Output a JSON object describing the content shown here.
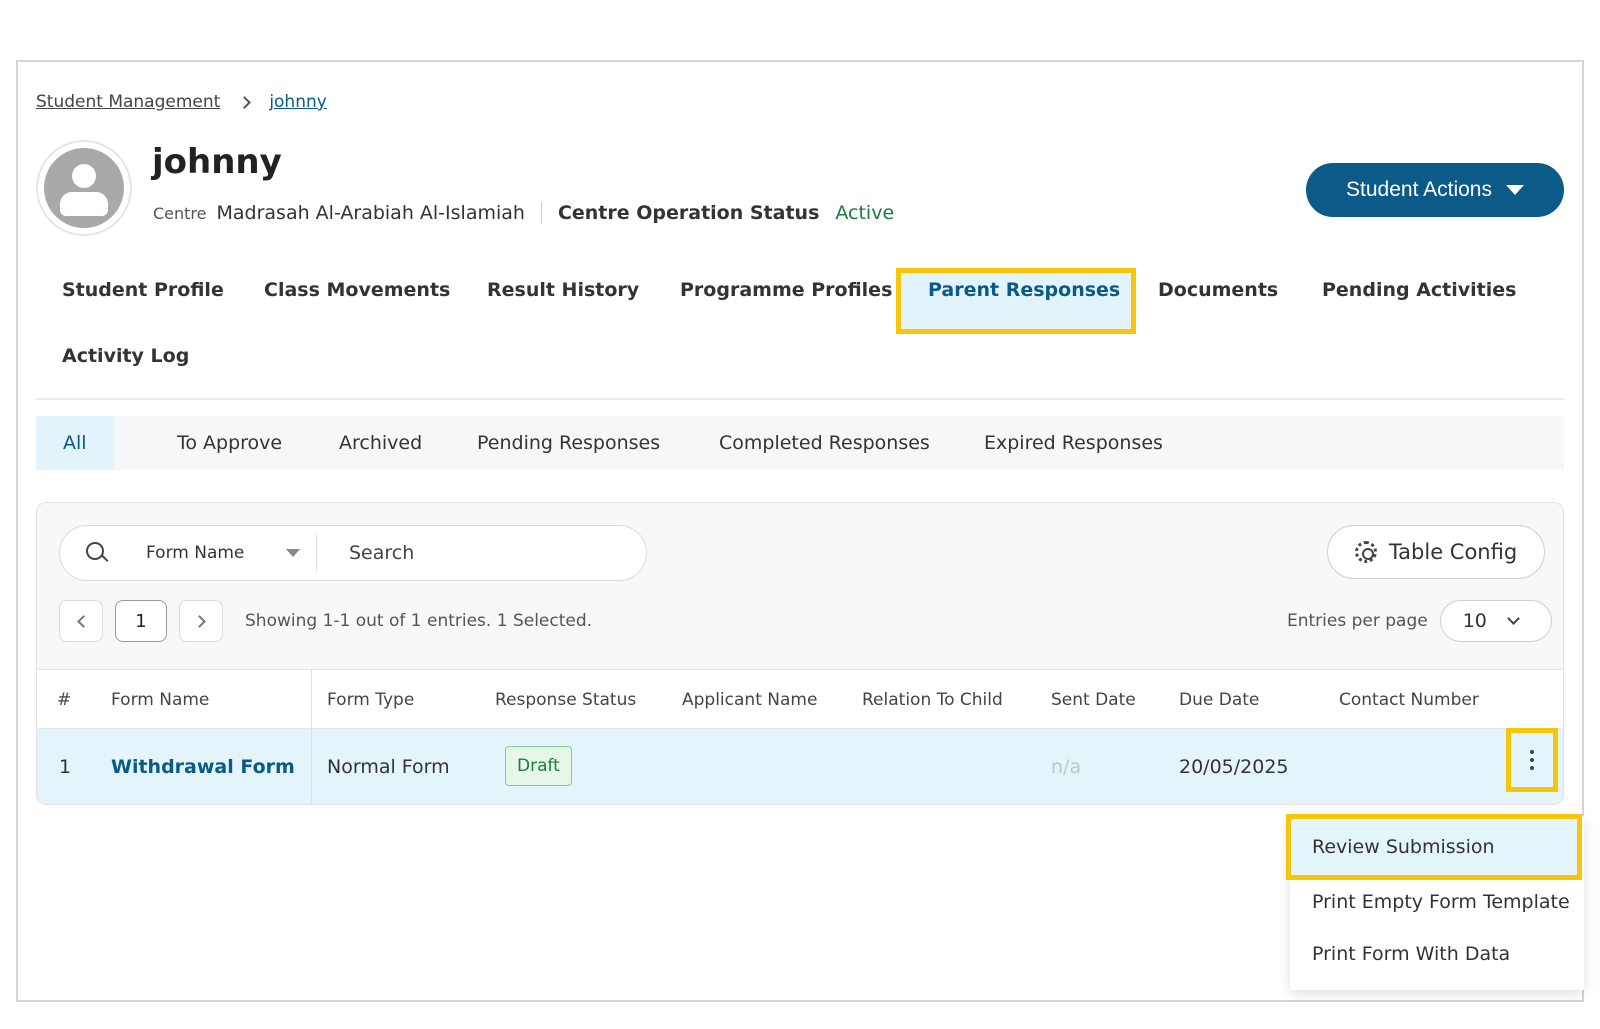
{
  "breadcrumb": {
    "root": "Student Management",
    "current": "johnny"
  },
  "student": {
    "name": "johnny",
    "centre_label": "Centre",
    "centre": "Madrasah Al-Arabiah Al-Islamiah",
    "status_label": "Centre Operation Status",
    "status": "Active"
  },
  "actions": {
    "label": "Student Actions"
  },
  "tabs": [
    {
      "label": "Student Profile"
    },
    {
      "label": "Class Movements"
    },
    {
      "label": "Result History"
    },
    {
      "label": "Programme Profiles"
    },
    {
      "label": "Parent Responses"
    },
    {
      "label": "Documents"
    },
    {
      "label": "Pending Activities"
    },
    {
      "label": "Activity Log"
    }
  ],
  "subtabs": [
    {
      "label": "All"
    },
    {
      "label": "To Approve"
    },
    {
      "label": "Archived"
    },
    {
      "label": "Pending Responses"
    },
    {
      "label": "Completed Responses"
    },
    {
      "label": "Expired Responses"
    }
  ],
  "search": {
    "field": "Form Name",
    "placeholder": "Search"
  },
  "table_config": {
    "label": "Table Config"
  },
  "pagination": {
    "page": "1",
    "showing": "Showing 1-1 out of 1 entries. 1 Selected.",
    "entries_label": "Entries per page",
    "entries_value": "10"
  },
  "table": {
    "headers": [
      "#",
      "Form Name",
      "Form Type",
      "Response Status",
      "Applicant Name",
      "Relation To Child",
      "Sent Date",
      "Due Date",
      "Contact Number"
    ],
    "rows": [
      {
        "index": "1",
        "form_name": "Withdrawal Form",
        "form_type": "Normal Form",
        "response_status": "Draft",
        "applicant_name": "",
        "relation": "",
        "sent_date": "n/a",
        "due_date": "20/05/2025",
        "contact": ""
      }
    ]
  },
  "menu": {
    "items": [
      {
        "label": "Review Submission"
      },
      {
        "label": "Print Empty Form Template"
      },
      {
        "label": "Print Form With Data"
      }
    ]
  },
  "colors": {
    "primary": "#0b5a87",
    "highlight": "#f5c60b",
    "active_bg": "#e3f3fb",
    "status_green": "#1c7c3c"
  }
}
